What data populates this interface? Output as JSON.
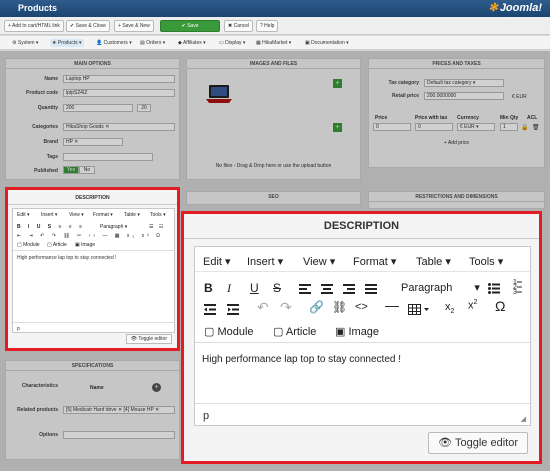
{
  "header": {
    "title": "Products",
    "logo": "Joomla!"
  },
  "toolbar": {
    "add_cart_link": "Add to cart/HTML link",
    "save_close": "Save & Close",
    "save_new": "Save & New",
    "save": "Save",
    "cancel": "Cancel",
    "help": "Help"
  },
  "menu": [
    "System",
    "Products",
    "Customers",
    "Orders",
    "Affiliates",
    "Display",
    "HikaMarket",
    "Documentation"
  ],
  "main_options": {
    "title": "MAIN OPTIONS",
    "name_label": "Name",
    "name_value": "Laptop HP",
    "code_label": "Product code",
    "code_value": "lptpS24IZ",
    "qty_label": "Quantity",
    "qty_value": "200",
    "qty_button": "20",
    "categories_label": "Categories",
    "categories_value": "HikaShop Goods",
    "brand_label": "Brand",
    "brand_value": "HP",
    "tags_label": "Tags",
    "published_label": "Published",
    "published_yes": "Yes",
    "published_no": "No"
  },
  "images": {
    "title": "IMAGES AND FILES",
    "no_files": "No files - Drag & Drop here or use the upload button"
  },
  "prices": {
    "title": "PRICES AND TAXES",
    "tax_label": "Tax category",
    "tax_value": "Default tax category",
    "retail_label": "Retail price",
    "retail_value": "200.0000000",
    "retail_currency": "€ EUR",
    "col_price": "Price",
    "col_price_tax": "Price with tax",
    "col_currency": "Currency",
    "col_minqty": "Min Qty",
    "col_acl": "ACL",
    "price_value": "0",
    "price_tax_value": "0",
    "currency_value": "€ EUR",
    "minqty_value": "1",
    "add_price": "Add price"
  },
  "seo": {
    "title": "SEO"
  },
  "restrictions": {
    "title": "RESTRICTIONS AND DIMENSIONS"
  },
  "specifications": {
    "title": "SPECIFICATIONS",
    "characteristics_label": "Characteristics",
    "name_col": "Name",
    "related_label": "Related products",
    "related_1": "[5] Medicatr Hard drive",
    "related_2": "[4] Mouse HP",
    "options_label": "Options"
  },
  "editor": {
    "title": "DESCRIPTION",
    "menus": [
      "Edit",
      "Insert",
      "View",
      "Format",
      "Table",
      "Tools"
    ],
    "paragraph": "Paragraph",
    "module": "Module",
    "article": "Article",
    "image": "Image",
    "content": "High performance lap top to stay connected !",
    "path": "p",
    "toggle": "Toggle editor"
  }
}
